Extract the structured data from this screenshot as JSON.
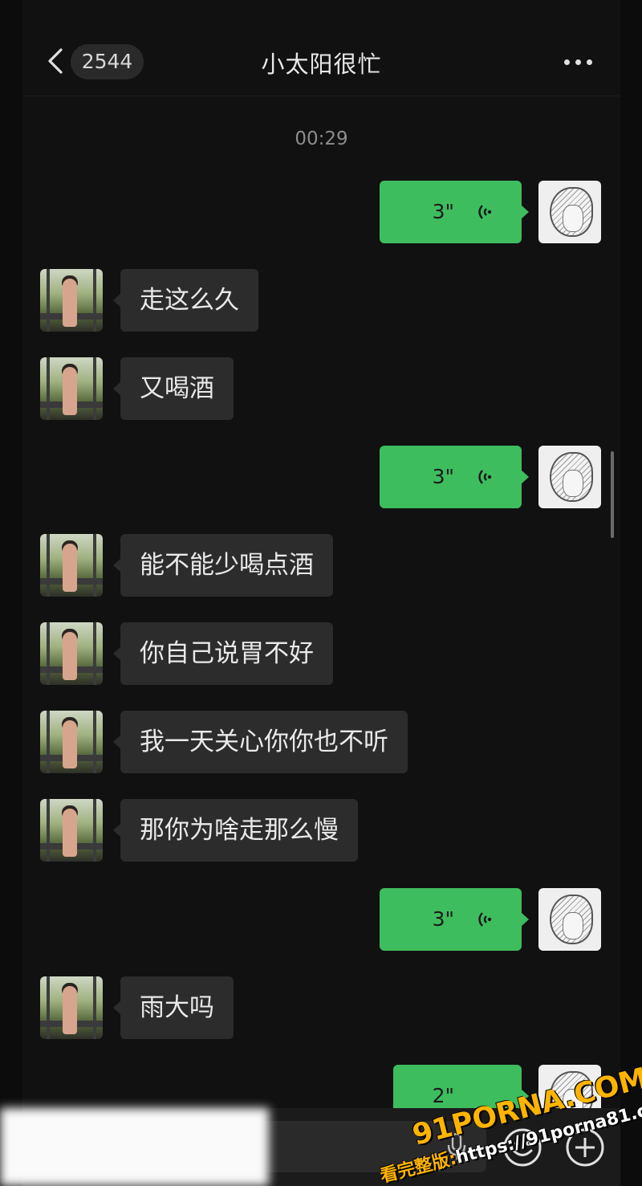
{
  "header": {
    "unread_count": "2544",
    "title": "小太阳很忙"
  },
  "timestamp": "00:29",
  "messages": [
    {
      "side": "out",
      "type": "voice",
      "duration": "3\""
    },
    {
      "side": "in",
      "type": "text",
      "text": "走这么久"
    },
    {
      "side": "in",
      "type": "text",
      "text": "又喝酒"
    },
    {
      "side": "out",
      "type": "voice",
      "duration": "3\""
    },
    {
      "side": "in",
      "type": "text",
      "text": "能不能少喝点酒"
    },
    {
      "side": "in",
      "type": "text",
      "text": "你自己说胃不好"
    },
    {
      "side": "in",
      "type": "text",
      "text": "我一天关心你你也不听"
    },
    {
      "side": "in",
      "type": "text",
      "text": "那你为啥走那么慢"
    },
    {
      "side": "out",
      "type": "voice",
      "duration": "3\""
    },
    {
      "side": "in",
      "type": "text",
      "text": "雨大吗"
    },
    {
      "side": "out",
      "type": "voice",
      "duration": "2\""
    }
  ],
  "watermark": {
    "brand": "91PORNA.COM",
    "line2_prefix": "看完整版:",
    "line2_url": "https://91porna81.com"
  },
  "icons": {
    "back": "chevron-left-icon",
    "more": "more-dots-icon",
    "voice_wave": "voice-wave-icon",
    "mic": "mic-icon",
    "emoji": "emoji-icon",
    "plus": "plus-icon"
  },
  "colors": {
    "outgoing_bubble": "#3ebd5e",
    "incoming_bubble": "#2c2c2c",
    "background": "#111111"
  }
}
